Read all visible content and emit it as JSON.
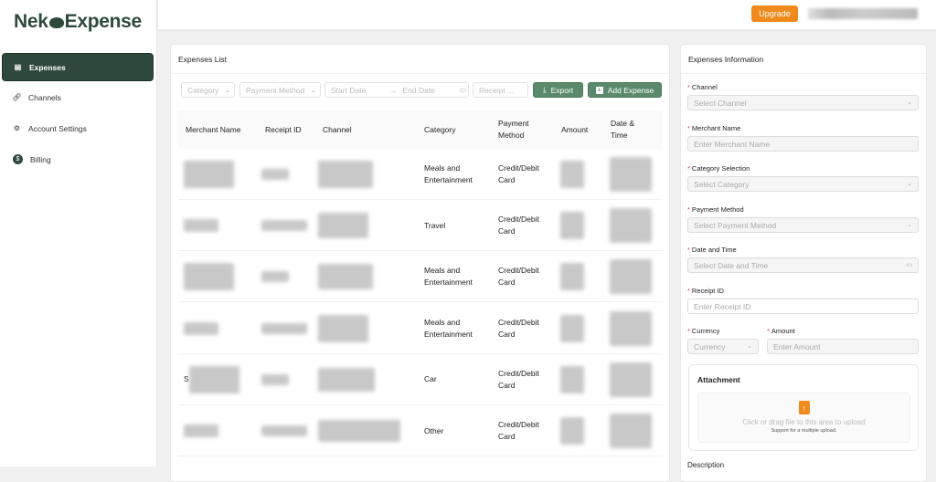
{
  "app": {
    "logo_left": "Nek",
    "logo_right": "Expense"
  },
  "sidebar": {
    "items": [
      {
        "label": "Expenses",
        "icon": "document-icon"
      },
      {
        "label": "Channels",
        "icon": "link-icon"
      },
      {
        "label": "Account Settings",
        "icon": "gear-icon"
      },
      {
        "label": "Billing",
        "icon": "dollar-icon"
      }
    ]
  },
  "header": {
    "upgrade": "Upgrade"
  },
  "list": {
    "title": "Expenses List",
    "filters": {
      "category": "Category",
      "payment": "Payment Method",
      "start": "Start Date",
      "end": "End Date",
      "receipt": "Receipt ..."
    },
    "export": "Export",
    "add": "Add Expense",
    "columns": [
      "Merchant Name",
      "Receipt ID",
      "Channel",
      "Category",
      "Payment Method",
      "Amount",
      "Date & Time"
    ],
    "rows": [
      {
        "merchant": "",
        "category": "Meals and Entertainment",
        "payment": "Credit/Debit Card"
      },
      {
        "merchant": "",
        "category": "Travel",
        "payment": "Credit/Debit Card"
      },
      {
        "merchant": "",
        "category": "Meals and Entertainment",
        "payment": "Credit/Debit Card"
      },
      {
        "merchant": "",
        "category": "Meals and Entertainment",
        "payment": "Credit/Debit Card"
      },
      {
        "merchant": "S",
        "category": "Car",
        "payment": "Credit/Debit Card"
      },
      {
        "merchant": "",
        "category": "Other",
        "payment": "Credit/Debit Card"
      }
    ]
  },
  "form": {
    "title": "Expenses Information",
    "channel_label": "Channel",
    "channel_ph": "Select Channel",
    "merchant_label": "Merchant Name",
    "merchant_ph": "Enter Merchant Name",
    "category_label": "Category Selection",
    "category_ph": "Select Category",
    "payment_label": "Payment Method",
    "payment_ph": "Select Payment Method",
    "date_label": "Date and Time",
    "date_ph": "Select Date and Time",
    "receipt_label": "Receipt ID",
    "receipt_ph": "Enter Receipt ID",
    "currency_label": "Currency",
    "currency_ph": "Currency",
    "amount_label": "Amount",
    "amount_ph": "Enter Amount",
    "attachment_title": "Attachment",
    "upload_text": "Click or drag file to this area to upload",
    "upload_hint": "Support for a multiple upload.",
    "description_label": "Description"
  }
}
